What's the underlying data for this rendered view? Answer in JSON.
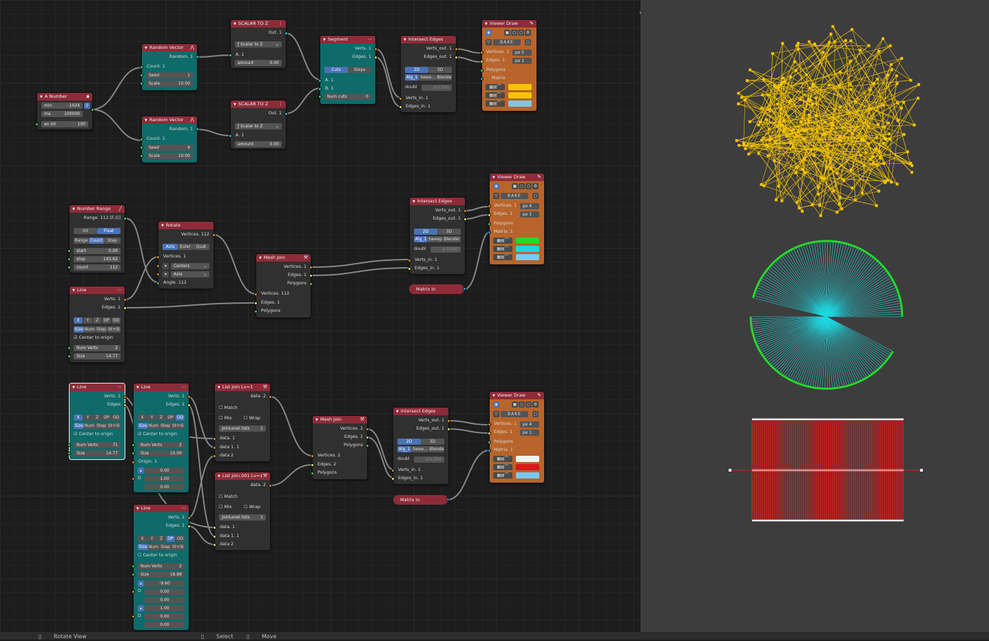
{
  "colors": {
    "header": "#8f2b38",
    "teal": "#0e6b69",
    "orange": "#b8642a",
    "yellow": "#f5c400",
    "cyan": "#1fd6e0",
    "green": "#22d82a",
    "red": "#d81a1a",
    "white": "#f2f2f2",
    "lightblue": "#7cc8ee"
  },
  "nodes": {
    "a_number": {
      "title": "A Number",
      "min_label": "min",
      "min_val": "-1024",
      "max_label": "ma",
      "max_val": "100000",
      "int_label": "an int",
      "int_val": "100"
    },
    "rv1": {
      "title": "Random Vector",
      "out": "Random. 1",
      "in_count": "Count. 1",
      "seed_label": "Seed",
      "seed_val": "1",
      "scale_label": "Scale",
      "scale_val": "10.00"
    },
    "rv2": {
      "title": "Random Vector",
      "out": "Random. 1",
      "in_count": "Count. 1",
      "seed_label": "Seed",
      "seed_val": "4",
      "scale_label": "Scale",
      "scale_val": "10.00"
    },
    "sz1": {
      "title": "SCALAR TO Z",
      "out": "Out. 1",
      "mode": "Scalar to Z",
      "in_a": "A. 1",
      "amount_label": "amount",
      "amount_val": "0.00"
    },
    "sz2": {
      "title": "SCALAR TO Z",
      "out": "Out. 1",
      "mode": "Scalar to Z",
      "in_a": "A. 1",
      "amount_label": "amount",
      "amount_val": "0.00"
    },
    "segment": {
      "title": "Segment",
      "out_verts": "Verts. 1",
      "out_edges": "Edges. 1",
      "cuts": "Cuts",
      "steps": "Steps",
      "in_a": "A. 1",
      "in_b": "B. 1",
      "numcuts_label": "Num cuts",
      "numcuts_val": "0"
    },
    "ie1": {
      "title": "Intersect Edges",
      "out_verts": "Verts_out. 1",
      "out_edges": "Edges_out. 1",
      "b2d": "2D",
      "b3d": "3D",
      "alg": "Alg_1",
      "sweep": "Swee...",
      "blender": "Blende",
      "doubl": "doubl",
      "d_val": "d 0.000",
      "in_verts": "Verts_in. 1",
      "in_edges": "Edges_in. 1"
    },
    "vd1": {
      "title": "Viewer Draw",
      "bake": "BAKE",
      "in_verts": "Vertices. 1",
      "in_edges": "Edges. 1",
      "in_polys": "Polygons",
      "in_matrix": "Matrix",
      "px_v": "px 5",
      "px_e": "px 1"
    },
    "nr": {
      "title": "Number Range",
      "out": "Range. 112 [F,G]",
      "int": "Int",
      "float": "Float",
      "range": "Range",
      "count_t": "Count",
      "step": "Step",
      "start_label": "start",
      "start_val": "0.00",
      "stop_label": "stop",
      "stop_val": "143.62",
      "count_label": "count",
      "count_val": "112"
    },
    "rot": {
      "title": "Rotate",
      "out": "Vertices. 112",
      "axis": "Axis",
      "euler": "Euler",
      "quat": "Quat",
      "in_verts": "Vertices. 1",
      "centers": "Centers",
      "axis_sel": "Axis",
      "angle": "Angle. 112"
    },
    "line1": {
      "title": "Line",
      "out_verts": "Verts. 1",
      "out_edges": "Edges. 1",
      "x": "X",
      "y": "Y",
      "z": "Z",
      "op": "OP",
      "od": "OD",
      "size": "Size",
      "num": "Num",
      "step": "Step",
      "stsi": "St+Si",
      "center": "Center to origin",
      "numverts_label": "Num Verts",
      "numverts_val": "2",
      "size_label": "Size",
      "size_val": "14.77"
    },
    "mj1": {
      "title": "Mesh Join",
      "out_verts": "Vertices. 1",
      "out_edges": "Edges. 1",
      "out_polys": "Polygons",
      "in_verts": "Vertices. 112",
      "in_edges": "Edges. 1",
      "in_polys": "Polygons"
    },
    "ie2": {
      "title": "Intersect Edges",
      "out_verts": "Verts_out. 1",
      "out_edges": "Edges_out. 1",
      "b2d": "2D",
      "b3d": "3D",
      "alg": "Alg_1",
      "sweep": "Sweep",
      "blender": "Blender",
      "doubl": "doubl",
      "d_val": "d 0.000",
      "in_verts": "Verts_in. 1",
      "in_edges": "Edges_in. 1"
    },
    "mi1": {
      "title": "Matrix In"
    },
    "vd2": {
      "title": "Viewer Draw",
      "bake": "BAKE",
      "in_verts": "Vertices. 1",
      "in_edges": "Edges. 1",
      "in_polys": "Polygons",
      "in_matrix": "Matrix. 1",
      "px_v": "px 4",
      "px_e": "px 1"
    },
    "line2": {
      "title": "Line",
      "out_verts": "Verts. 1",
      "out_edges": "Edges",
      "x": "X",
      "y": "Y",
      "z": "Z",
      "op": "OP",
      "od": "OD",
      "size": "Size",
      "num": "Num",
      "step": "Step",
      "stsi": "St+Si",
      "center": "Center to origin",
      "numverts_label": "Num Verts",
      "numverts_val": "71",
      "size_label": "Size",
      "size_val": "14.77"
    },
    "line3": {
      "title": "Line",
      "out_verts": "Verts. 1",
      "out_edges": "Edges. 1",
      "x": "X",
      "y": "Y",
      "z": "Z",
      "op": "OP",
      "od": "OD",
      "size": "Size",
      "num": "Num",
      "step": "Step",
      "stsi": "St+Si",
      "center": "Center to origin",
      "numverts_label": "Num Verts",
      "numverts_val": "2",
      "size_label": "Size",
      "size_val": "10.00",
      "origin": "Origin. 1",
      "o1": "0.00",
      "o_d": "D",
      "o2": "1.00",
      "o3": "0.00"
    },
    "line4": {
      "title": "Line",
      "out_verts": "Verts. 1",
      "out_edges": "Edges. 1",
      "x": "X",
      "y": "Y",
      "z": "Z",
      "op": "OP",
      "od": "OD",
      "size": "Size",
      "num": "Num",
      "step": "Step",
      "stsi": "St+Si",
      "center": "Center to origin",
      "numverts_label": "Num Verts",
      "numverts_val": "2",
      "size_label": "Size",
      "size_val": "18.88",
      "v1": "-9.60",
      "o_label": "O",
      "v2": "0.00",
      "v3": "0.00",
      "w1": "1.00",
      "d_label": "D",
      "w2": "0.00",
      "w3": "0.00"
    },
    "lj1": {
      "title": "List Join Lv=1",
      "out": "data. 2",
      "match": "Match",
      "mix": "Mix",
      "wrap": "Wrap",
      "joinlevel": "JoinLevel lists",
      "jl_val": "1",
      "in1": "data. 1",
      "in2": "data 1. 1",
      "in3": "data 2"
    },
    "lj2": {
      "title": "List Join.001 Lv=1",
      "out": "data. 2",
      "match": "Match",
      "mix": "Mix",
      "wrap": "Wrap",
      "joinlevel": "JoinLevel lists",
      "jl_val": "1",
      "in1": "data. 1",
      "in2": "data 1. 1",
      "in3": "data 2"
    },
    "mj2": {
      "title": "Mesh Join",
      "out_verts": "Vertices. 1",
      "out_edges": "Edges. 1",
      "out_polys": "Polygons",
      "in_verts": "Vertices. 2",
      "in_edges": "Edges. 2",
      "in_polys": "Polygons"
    },
    "ie3": {
      "title": "Intersect Edges",
      "out_verts": "Verts_out. 1",
      "out_edges": "Edges_out. 1",
      "b2d": "2D",
      "b3d": "3D",
      "alg": "Alg_1",
      "sweep": "Swee...",
      "blender": "Blende",
      "doubl": "doubl",
      "d_val": "d 0.000",
      "in_verts": "Verts_in. 1",
      "in_edges": "Edges_in. 1"
    },
    "mi2": {
      "title": "Matrix In"
    },
    "vd3": {
      "title": "Viewer Draw",
      "bake": "BAKE",
      "in_verts": "Vertices. 1",
      "in_edges": "Edges. 1",
      "in_polys": "Polygons",
      "in_matrix": "Matrix. 1",
      "px_v": "px 4",
      "px_e": "px 1"
    }
  },
  "statusbar": {
    "rotate": "Rotate View",
    "select": "Select",
    "move": "Move"
  }
}
